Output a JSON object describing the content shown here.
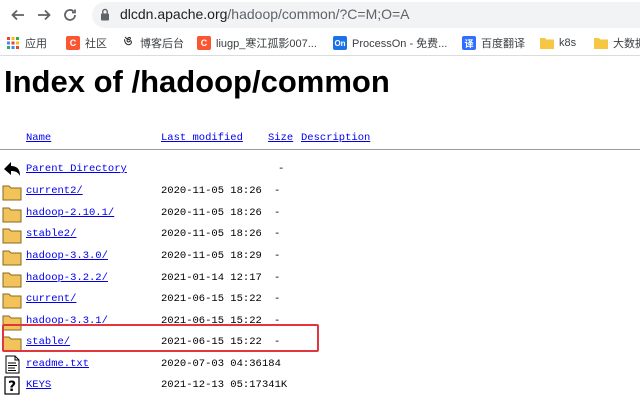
{
  "browser": {
    "url_host": "dlcdn.apache.org",
    "url_path": "/hadoop/common/?C=M;O=A"
  },
  "bookmarks": [
    {
      "label": "应用",
      "icon": "apps-grid-icon",
      "color": "#ea4335"
    },
    {
      "label": "社区",
      "icon": "csdn-icon",
      "color": "#fc5531"
    },
    {
      "label": "博客后台",
      "icon": "blog-icon",
      "color": "#333333"
    },
    {
      "label": "liugp_寒江孤影007...",
      "icon": "csdn-icon",
      "color": "#fc5531"
    },
    {
      "label": "ProcessOn - 免费...",
      "icon": "processon-icon",
      "color": "#1a73e8"
    },
    {
      "label": "百度翻译",
      "icon": "translate-icon",
      "color": "#2f6fff"
    },
    {
      "label": "k8s",
      "icon": "folder-icon",
      "color": "#f6c744"
    },
    {
      "label": "大数据",
      "icon": "folder-icon",
      "color": "#f6c744"
    }
  ],
  "page": {
    "title": "Index of /hadoop/common",
    "headers": {
      "name": "Name",
      "last_modified": "Last modified",
      "size": "Size",
      "description": "Description"
    },
    "parent": {
      "name": "Parent Directory",
      "size": "-"
    },
    "entries": [
      {
        "name": "current2/",
        "date": "2020-11-05 18:26",
        "size": "-",
        "icon": "folder-icon"
      },
      {
        "name": "hadoop-2.10.1/",
        "date": "2020-11-05 18:26",
        "size": "-",
        "icon": "folder-icon"
      },
      {
        "name": "stable2/",
        "date": "2020-11-05 18:26",
        "size": "-",
        "icon": "folder-icon"
      },
      {
        "name": "hadoop-3.3.0/",
        "date": "2020-11-05 18:29",
        "size": "-",
        "icon": "folder-icon"
      },
      {
        "name": "hadoop-3.2.2/",
        "date": "2021-01-14 12:17",
        "size": "-",
        "icon": "folder-icon"
      },
      {
        "name": "current/",
        "date": "2021-06-15 15:22",
        "size": "-",
        "icon": "folder-icon"
      },
      {
        "name": "hadoop-3.3.1/",
        "date": "2021-06-15 15:22",
        "size": "-",
        "icon": "folder-icon"
      },
      {
        "name": "stable/",
        "date": "2021-06-15 15:22",
        "size": "-",
        "icon": "folder-icon"
      },
      {
        "name": "readme.txt",
        "date": "2020-07-03 04:36",
        "size": "184",
        "icon": "text-file-icon"
      },
      {
        "name": "KEYS",
        "date": "2021-12-13 05:17",
        "size": "341K",
        "icon": "unknown-file-icon"
      }
    ],
    "highlight_color": "#e2363f"
  }
}
